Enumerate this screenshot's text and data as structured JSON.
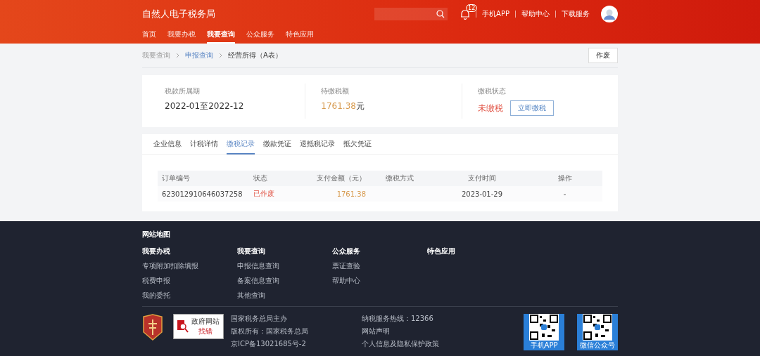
{
  "header": {
    "title": "自然人电子税务局",
    "notification_count": "12",
    "links": [
      "手机APP",
      "帮助中心",
      "下载服务"
    ]
  },
  "nav": [
    {
      "label": "首页",
      "selected": false
    },
    {
      "label": "我要办税",
      "selected": false
    },
    {
      "label": "我要查询",
      "selected": true
    },
    {
      "label": "公众服务",
      "selected": false
    },
    {
      "label": "特色应用",
      "selected": false
    }
  ],
  "breadcrumb": [
    {
      "label": "我要查询",
      "kind": "plain"
    },
    {
      "label": "申报查询",
      "kind": "link"
    },
    {
      "label": "经营所得（A表）",
      "kind": "current"
    }
  ],
  "void_button": "作废",
  "summary": [
    {
      "label": "税款所属期",
      "value": "2022-01至2022-12",
      "kind": "period"
    },
    {
      "label": "待缴税额",
      "value": "1761.38",
      "unit": "元",
      "kind": "amount"
    },
    {
      "label": "缴税状态",
      "value": "未缴税",
      "kind": "status",
      "button": "立即缴税"
    }
  ],
  "tabs": [
    {
      "label": "企业信息",
      "selected": false
    },
    {
      "label": "计税详情",
      "selected": false
    },
    {
      "label": "缴税记录",
      "selected": true
    },
    {
      "label": "缴款凭证",
      "selected": false
    },
    {
      "label": "退抵税记录",
      "selected": false
    },
    {
      "label": "抵欠凭证",
      "selected": false
    }
  ],
  "table": {
    "columns": [
      "订单编号",
      "状态",
      "支付金额（元）",
      "缴税方式",
      "支付时间",
      "操作"
    ],
    "rows": [
      [
        "623012910646037258",
        "已作废",
        "1761.38",
        "",
        "2023-01-29",
        "-"
      ]
    ]
  },
  "footer": {
    "sitemap_title": "网站地图",
    "columns": [
      {
        "title": "我要办税",
        "items": [
          "专项附加扣除填报",
          "税费申报",
          "我的委托"
        ]
      },
      {
        "title": "我要查询",
        "items": [
          "申报信息查询",
          "备案信息查询",
          "其他查询"
        ]
      },
      {
        "title": "公众服务",
        "items": [
          "票证查验",
          "帮助中心"
        ]
      },
      {
        "title": "特色应用"
      }
    ],
    "gov_badge": [
      "政府网站",
      "找错"
    ],
    "info_left": [
      "国家税务总局主办",
      "版权所有：国家税务总局",
      "京ICP备13021685号-2"
    ],
    "info_right": [
      "纳税服务热线：12366",
      "网站声明",
      "个人信息及隐私保护政策"
    ],
    "qr_codes": [
      "手机APP",
      "微信公众号"
    ]
  }
}
